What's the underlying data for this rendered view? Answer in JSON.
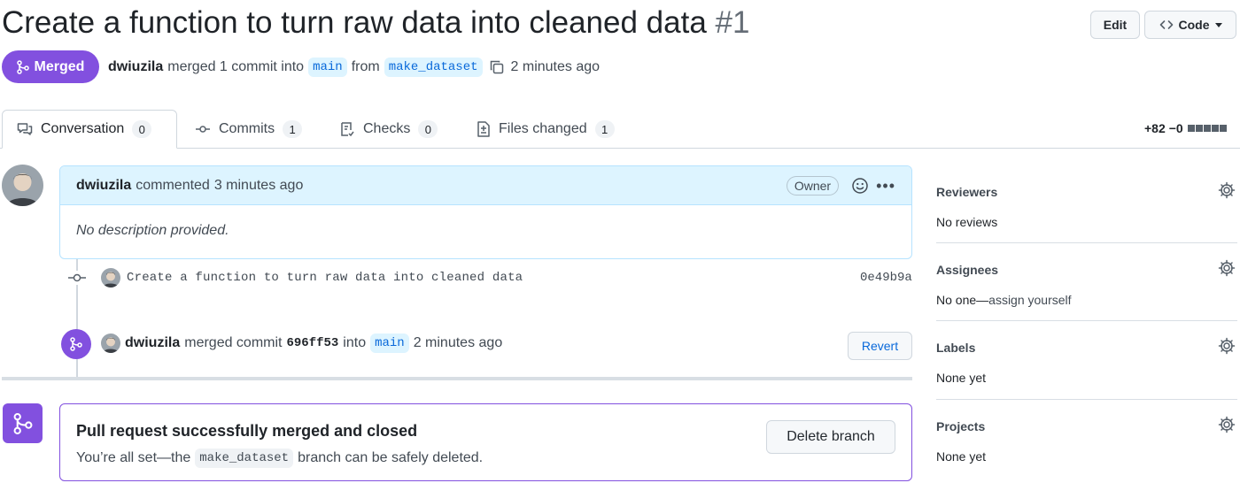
{
  "header": {
    "title": "Create a function to turn raw data into cleaned data",
    "number": "#1",
    "edit_label": "Edit",
    "code_label": "Code"
  },
  "status": {
    "state": "Merged",
    "author": "dwiuzila",
    "action": "merged 1 commit into",
    "base_branch": "main",
    "from_word": "from",
    "head_branch": "make_dataset",
    "time": "2 minutes ago"
  },
  "tabs": [
    {
      "label": "Conversation",
      "count": "0",
      "icon": "comment-discussion-icon"
    },
    {
      "label": "Commits",
      "count": "1",
      "icon": "git-commit-icon"
    },
    {
      "label": "Checks",
      "count": "0",
      "icon": "checklist-icon"
    },
    {
      "label": "Files changed",
      "count": "1",
      "icon": "file-diff-icon"
    }
  ],
  "diffstat": {
    "additions": "+82",
    "deletions": "−0"
  },
  "comment": {
    "author": "dwiuzila",
    "action": "commented",
    "time": "3 minutes ago",
    "role": "Owner",
    "body": "No description provided."
  },
  "commit": {
    "message": "Create a function to turn raw data into cleaned data",
    "sha": "0e49b9a"
  },
  "merge_event": {
    "author": "dwiuzila",
    "action": "merged commit",
    "sha": "696ff53",
    "into_word": "into",
    "branch": "main",
    "time": "2 minutes ago",
    "revert_label": "Revert"
  },
  "merged_box": {
    "title": "Pull request successfully merged and closed",
    "sub_before": "You’re all set—the",
    "branch": "make_dataset",
    "sub_after": "branch can be safely deleted.",
    "delete_label": "Delete branch"
  },
  "sidebar": {
    "reviewers": {
      "title": "Reviewers",
      "value": "No reviews"
    },
    "assignees": {
      "title": "Assignees",
      "value_prefix": "No one—",
      "value_link": "assign yourself"
    },
    "labels": {
      "title": "Labels",
      "value": "None yet"
    },
    "projects": {
      "title": "Projects",
      "value": "None yet"
    }
  },
  "colors": {
    "merged": "#8250df",
    "comment_header": "#ddf4ff",
    "link": "#0969da"
  }
}
